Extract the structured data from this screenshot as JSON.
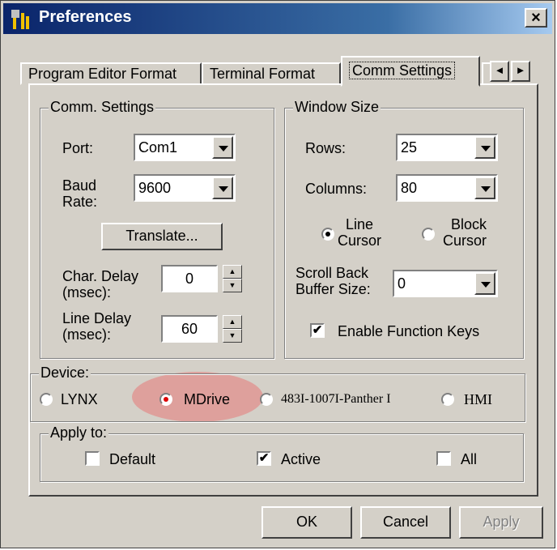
{
  "window": {
    "title": "Preferences",
    "close_glyph": "×"
  },
  "tabs": [
    {
      "label": "Program Editor Format"
    },
    {
      "label": "Terminal Format"
    },
    {
      "label": "Comm Settings"
    }
  ],
  "tab_scroll": {
    "left": "◄",
    "right": "►"
  },
  "comm_settings": {
    "legend": "Comm. Settings",
    "port_label": "Port:",
    "port_value": "Com1",
    "baud_label_1": "Baud",
    "baud_label_2": "Rate:",
    "baud_value": "9600",
    "translate_button": "Translate...",
    "char_delay_label_1": "Char. Delay",
    "char_delay_label_2": "(msec):",
    "char_delay_value": "0",
    "line_delay_label_1": "Line Delay",
    "line_delay_label_2": "(msec):",
    "line_delay_value": "60"
  },
  "window_size": {
    "legend": "Window Size",
    "rows_label": "Rows:",
    "rows_value": "25",
    "columns_label": "Columns:",
    "columns_value": "80",
    "line_cursor_1": "Line",
    "line_cursor_2": "Cursor",
    "block_cursor_1": "Block",
    "block_cursor_2": "Cursor",
    "scroll_back_1": "Scroll Back",
    "scroll_back_2": "Buffer Size:",
    "scroll_back_value": "0",
    "enable_function_keys": "Enable Function Keys",
    "enable_function_keys_checked": true
  },
  "device": {
    "legend": "Device:",
    "options": [
      "LYNX",
      "MDrive",
      "483I-1007I-Panther I",
      "HMI"
    ],
    "selected": "MDrive"
  },
  "apply_to": {
    "legend": "Apply to:",
    "default_label": "Default",
    "active_label": "Active",
    "all_label": "All",
    "default_checked": false,
    "active_checked": true,
    "all_checked": false
  },
  "buttons": {
    "ok": "OK",
    "cancel": "Cancel",
    "apply": "Apply"
  },
  "colors": {
    "highlight": "#e67878",
    "title_bar": "#0a246a",
    "face": "#d4d0c8"
  }
}
